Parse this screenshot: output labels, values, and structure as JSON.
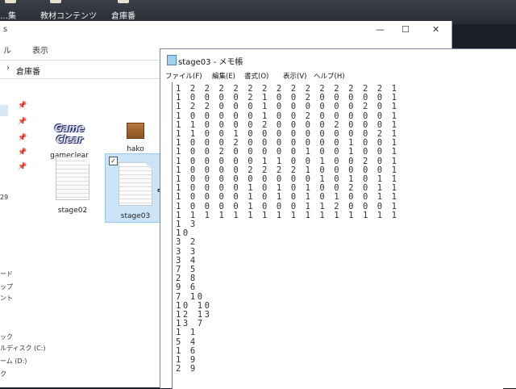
{
  "desktop": {
    "items": [
      {
        "label": "…集"
      },
      {
        "label": "教材コンテンツ"
      },
      {
        "label": "倉庫番"
      }
    ]
  },
  "explorer": {
    "title_fragment": "s",
    "ribbon": [
      "ル",
      "表示"
    ],
    "address": "倉庫番",
    "nav_labels": [
      "29",
      "ード",
      "ップ",
      "ント",
      "ック",
      "ルディスク (C:)",
      "ーム (D:)",
      "ク"
    ],
    "files": [
      {
        "name": "gameclear",
        "logo_text": "Game Clear"
      },
      {
        "name": "hako"
      },
      {
        "name": "stage02"
      },
      {
        "name": "stage03",
        "selected": true
      }
    ]
  },
  "notepad": {
    "title": "stage03 - メモ帳",
    "menu": [
      "ファイル(F)",
      "編集(E)",
      "書式(O)",
      "表示(V)",
      "ヘルプ(H)"
    ],
    "lines": [
      "1 2 2 2 2 2 2 2 2 2 2 2 2 2 2 1",
      "1 0 0 0 0 2 1 0 0 2 0 0 0 0 0 1",
      "1 2 2 0 0 0 1 0 0 0 0 0 0 2 0 1",
      "1 0 0 0 0 0 1 0 0 2 0 0 0 0 0 1",
      "1 1 0 0 0 0 2 0 0 0 0 2 0 0 0 1",
      "1 1 0 0 1 0 0 0 0 0 0 0 0 0 2 1",
      "1 0 0 0 2 0 0 0 0 0 0 0 1 0 0 1",
      "1 0 0 2 0 0 0 0 0 1 0 0 1 0 0 1",
      "1 0 0 0 0 0 1 1 0 0 1 0 0 2 0 1",
      "1 0 0 0 0 2 2 2 2 1 0 0 0 0 0 1",
      "1 0 0 0 0 0 0 0 0 0 1 0 1 0 1 1",
      "1 0 0 0 0 1 0 1 0 1 0 0 2 0 1 1",
      "1 0 0 0 0 1 0 1 0 1 0 1 0 0 1 1",
      "1 0 0 0 0 1 0 0 0 1 1 2 0 0 0 1",
      "1 1 1 1 1 1 1 1 1 1 1 1 1 1 1 1",
      "1 3",
      "10",
      "3 2",
      "3 3",
      "3 4",
      "7 5",
      "2 8",
      "9 6",
      "7 10",
      "10 10",
      "12 13",
      "13 7",
      "1 1",
      "5 4",
      "1 6",
      "1 9",
      "2 9"
    ]
  },
  "colors": {
    "selection": "#cce4f7",
    "window_bg": "#ffffff",
    "background": "#1b1f27"
  }
}
